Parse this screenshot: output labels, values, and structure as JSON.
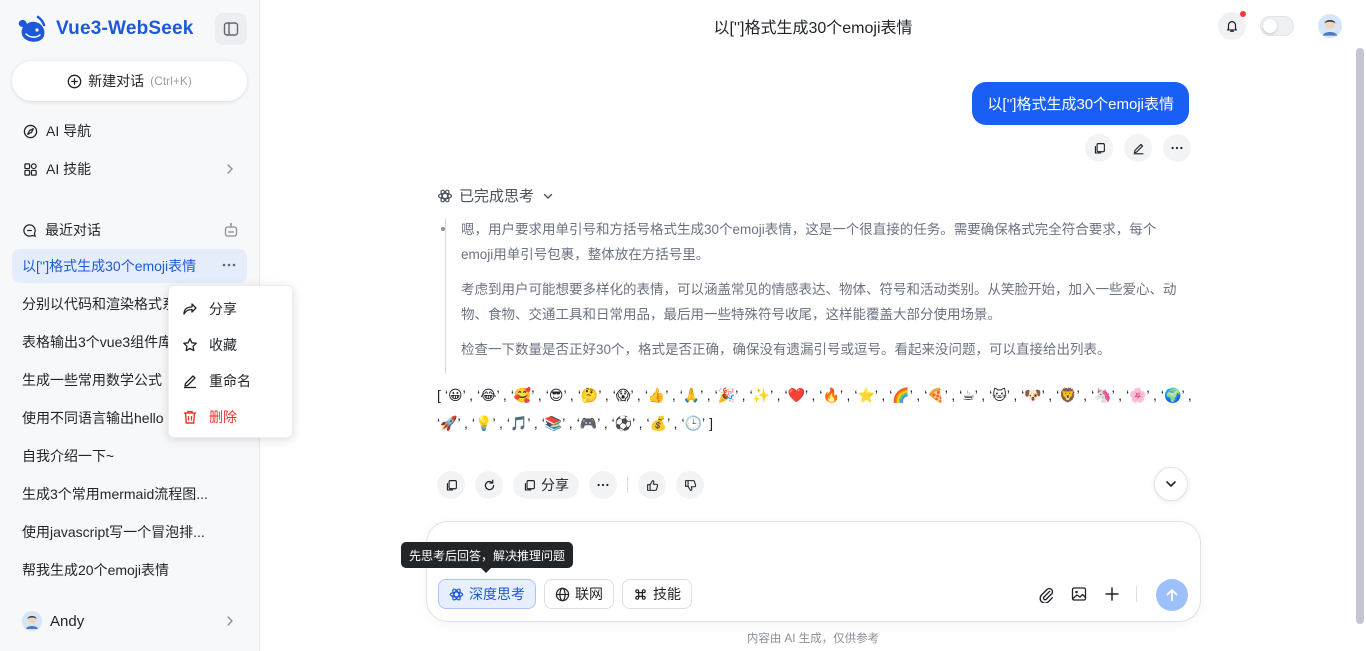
{
  "app": {
    "logo_text": "Vue3-WebSeek",
    "new_chat_label": "新建对话",
    "new_chat_shortcut": "(Ctrl+K)",
    "accent_color": "#1a5ff5"
  },
  "sidebar": {
    "nav": [
      {
        "label": "AI 导航",
        "icon": "compass-icon"
      },
      {
        "label": "AI 技能",
        "icon": "grid-icon"
      }
    ],
    "recent_label": "最近对话",
    "conversations": [
      {
        "title": "以['']格式生成30个emoji表情",
        "active": true
      },
      {
        "title": "分别以代码和渲染格式系"
      },
      {
        "title": "表格输出3个vue3组件库"
      },
      {
        "title": "生成一些常用数学公式"
      },
      {
        "title": "使用不同语言输出hello"
      },
      {
        "title": "自我介绍一下~"
      },
      {
        "title": "生成3个常用mermaid流程图..."
      },
      {
        "title": "使用javascript写一个冒泡排..."
      },
      {
        "title": "帮我生成20个emoji表情"
      }
    ],
    "user_name": "Andy"
  },
  "context_menu": {
    "share": "分享",
    "favorite": "收藏",
    "rename": "重命名",
    "delete": "删除"
  },
  "header": {
    "title": "以['']格式生成30个emoji表情"
  },
  "chat": {
    "user_message": "以['']格式生成30个emoji表情",
    "think_title": "已完成思考",
    "think_paragraphs": [
      "嗯，用户要求用单引号和方括号格式生成30个emoji表情，这是一个很直接的任务。需要确保格式完全符合要求，每个emoji用单引号包裹，整体放在方括号里。",
      "考虑到用户可能想要多样化的表情，可以涵盖常见的情感表达、物体、符号和活动类别。从笑脸开始，加入一些爱心、动物、食物、交通工具和日常用品，最后用一些特殊符号收尾，这样能覆盖大部分使用场景。",
      "检查一下数量是否正好30个，格式是否正确，确保没有遗漏引号或逗号。看起来没问题，可以直接给出列表。"
    ],
    "emojis": [
      "😀",
      "😂",
      "🥰",
      "😎",
      "🤔",
      "😱",
      "👍",
      "🙏",
      "🎉",
      "✨",
      "❤️",
      "🔥",
      "⭐",
      "🌈",
      "🍕",
      "☕",
      "🐱",
      "🐶",
      "🦁",
      "🦄",
      "🌸",
      "🌍",
      "🚀",
      "💡",
      "🎵",
      "📚",
      "🎮",
      "⚽",
      "💰",
      "🕒"
    ],
    "share_label": "分享"
  },
  "composer": {
    "tooltip": "先思考后回答，解决推理问题",
    "deep_think_label": "深度思考",
    "web_label": "联网",
    "skills_label": "技能"
  },
  "footer_note": "内容由 AI 生成，仅供参考"
}
